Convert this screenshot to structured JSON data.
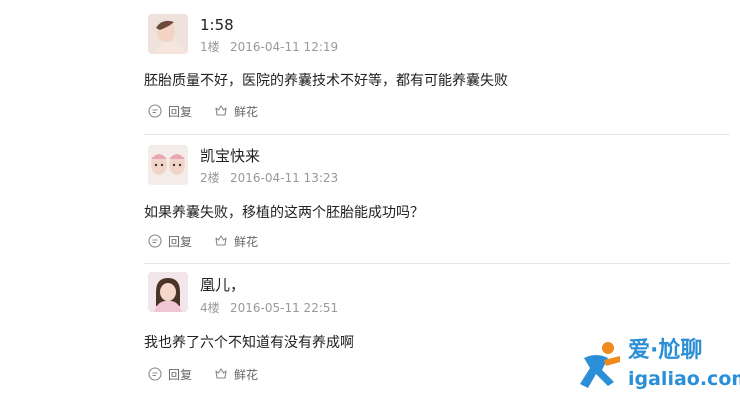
{
  "posts": [
    {
      "username": "1:58",
      "floor": "1楼",
      "timestamp": "2016-04-11 12:19",
      "text": "胚胎质量不好，医院的养囊技术不好等，都有可能养囊失败",
      "reply_label": "回复",
      "flower_label": "鲜花"
    },
    {
      "username": "凯宝快来",
      "floor": "2楼",
      "timestamp": "2016-04-11 13:23",
      "text": "如果养囊失败，移植的这两个胚胎能成功吗？",
      "reply_label": "回复",
      "flower_label": "鲜花"
    },
    {
      "username": "凰儿，",
      "floor": "4楼",
      "timestamp": "2016-05-11 22:51",
      "text": "我也养了六个不知道有没有养成啊",
      "reply_label": "回复",
      "flower_label": "鲜花"
    }
  ],
  "watermark": {
    "name": "爱·尬聊",
    "url": "igaliao.com",
    "color": "#2a8fd6",
    "accent": "#f08a1c"
  }
}
